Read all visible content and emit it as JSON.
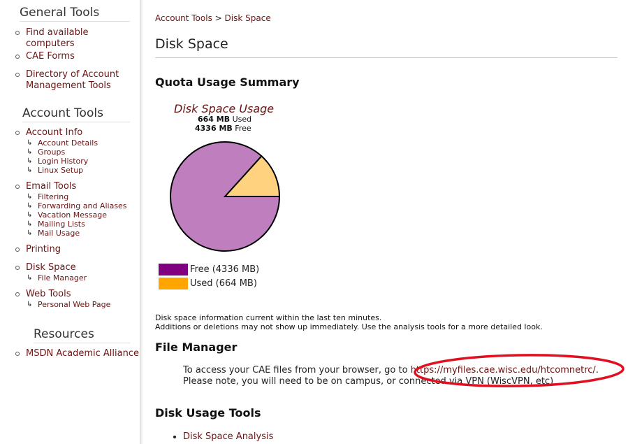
{
  "sidebar": {
    "general_heading": "General Tools",
    "general_items": [
      "Find available computers",
      "CAE Forms",
      "Directory of Account Management Tools"
    ],
    "account_heading": "Account Tools",
    "account_info": {
      "label": "Account Info",
      "subs": [
        "Account Details",
        "Groups",
        "Login History",
        "Linux Setup"
      ]
    },
    "email_tools": {
      "label": "Email Tools",
      "subs": [
        "Filtering",
        "Forwarding and Aliases",
        "Vacation Message",
        "Mailing Lists",
        "Mail Usage"
      ]
    },
    "printing": "Printing",
    "disk_space": {
      "label": "Disk Space",
      "subs": [
        "File Manager"
      ]
    },
    "web_tools": {
      "label": "Web Tools",
      "subs": [
        "Personal Web Page"
      ]
    },
    "resources_heading": "Resources",
    "resources_items": [
      "MSDN Academic Alliance"
    ]
  },
  "breadcrumb": {
    "parent": "Account Tools",
    "separator": ">",
    "current": "Disk Space"
  },
  "page_title": "Disk Space",
  "quota": {
    "heading": "Quota Usage Summary",
    "chart_title": "Disk Space Usage",
    "used_value": "664 MB",
    "used_label": "Used",
    "free_value": "4336 MB",
    "free_label": "Free",
    "legend_free": "Free (4336 MB)",
    "legend_used": "Used (664 MB)"
  },
  "chart_data": {
    "type": "pie",
    "title": "Disk Space Usage",
    "slices": [
      {
        "label": "Free",
        "value": 4336,
        "color": "#bf7fbf",
        "legend_color": "#800080"
      },
      {
        "label": "Used",
        "value": 664,
        "color": "#ffd27f",
        "legend_color": "#ffa500"
      }
    ]
  },
  "info": {
    "line1": "Disk space information current within the last ten minutes.",
    "line2": "Additions or deletions may not show up immediately. Use the analysis tools for a more detailed look."
  },
  "file_manager": {
    "heading": "File Manager",
    "text_before": "To access your CAE files from your browser, go to ",
    "link": "https://myfiles.cae.wisc.edu/htcomnetrc/",
    "text_after": ".",
    "note": "Please note, you will need to be on campus, or connected via VPN (WiscVPN, etc)"
  },
  "tools": {
    "heading": "Disk Usage Tools",
    "items": [
      "Disk Space Analysis"
    ]
  },
  "colors": {
    "link": "#6b1313",
    "annotation": "#e01020"
  }
}
